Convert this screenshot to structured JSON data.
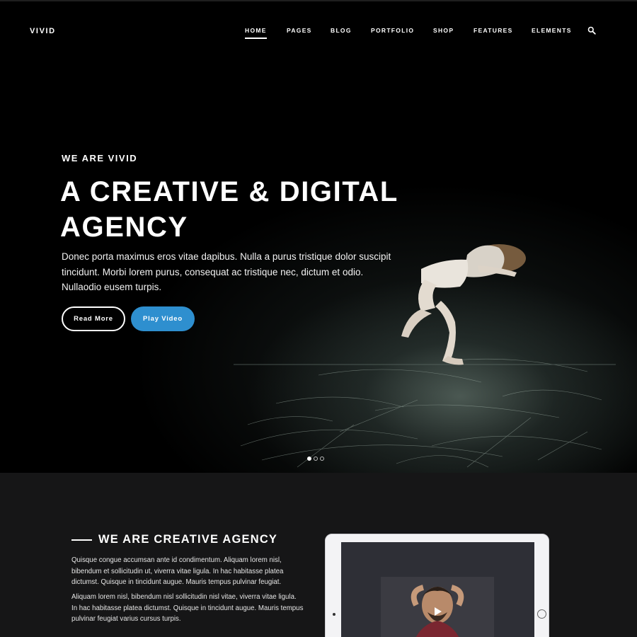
{
  "header": {
    "logo": "VIVID",
    "nav": [
      {
        "label": "HOME",
        "active": true
      },
      {
        "label": "PAGES",
        "active": false
      },
      {
        "label": "BLOG",
        "active": false
      },
      {
        "label": "PORTFOLIO",
        "active": false
      },
      {
        "label": "SHOP",
        "active": false
      },
      {
        "label": "FEATURES",
        "active": false
      },
      {
        "label": "ELEMENTS",
        "active": false
      }
    ],
    "search_icon": "search-icon"
  },
  "hero": {
    "eyebrow": "WE ARE VIVID",
    "headline_line1": "A CREATIVE & DIGITAL",
    "headline_line2": "AGENCY",
    "lede_line1": "Donec porta maximus eros vitae dapibus. Nulla a purus tristique dolor suscipit",
    "lede_line2": "tincidunt. Morbi lorem purus, consequat ac tristique nec, dictum et odio.",
    "lede_line3": "Nullaodio eusem turpis.",
    "buttons": {
      "read_more": "Read More",
      "play_video": "Play Video"
    },
    "slider": {
      "slides": 3,
      "active_index": 0
    }
  },
  "about": {
    "title": "WE ARE CREATIVE AGENCY",
    "para1_line1": "Quisque congue accumsan ante id condimentum. Aliquam lorem nisl,",
    "para1_line2": "bibendum et sollicitudin ut, viverra vitae ligula. In hac habitasse platea",
    "para1_line3": "dictumst. Quisque in tincidunt augue. Mauris tempus pulvinar feugiat.",
    "para2_line1": "Aliquam lorem nisl, bibendum nisl sollicitudin nisl vitae, viverra vitae ligula.",
    "para2_line2": "In hac habitasse platea dictumst. Quisque in tincidunt augue. Mauris tempus",
    "para2_line3": "pulvinar feugiat varius cursus turpis."
  },
  "colors": {
    "accent": "#2e8fcf",
    "hero_bg": "#000000",
    "section_bg": "#161617"
  }
}
